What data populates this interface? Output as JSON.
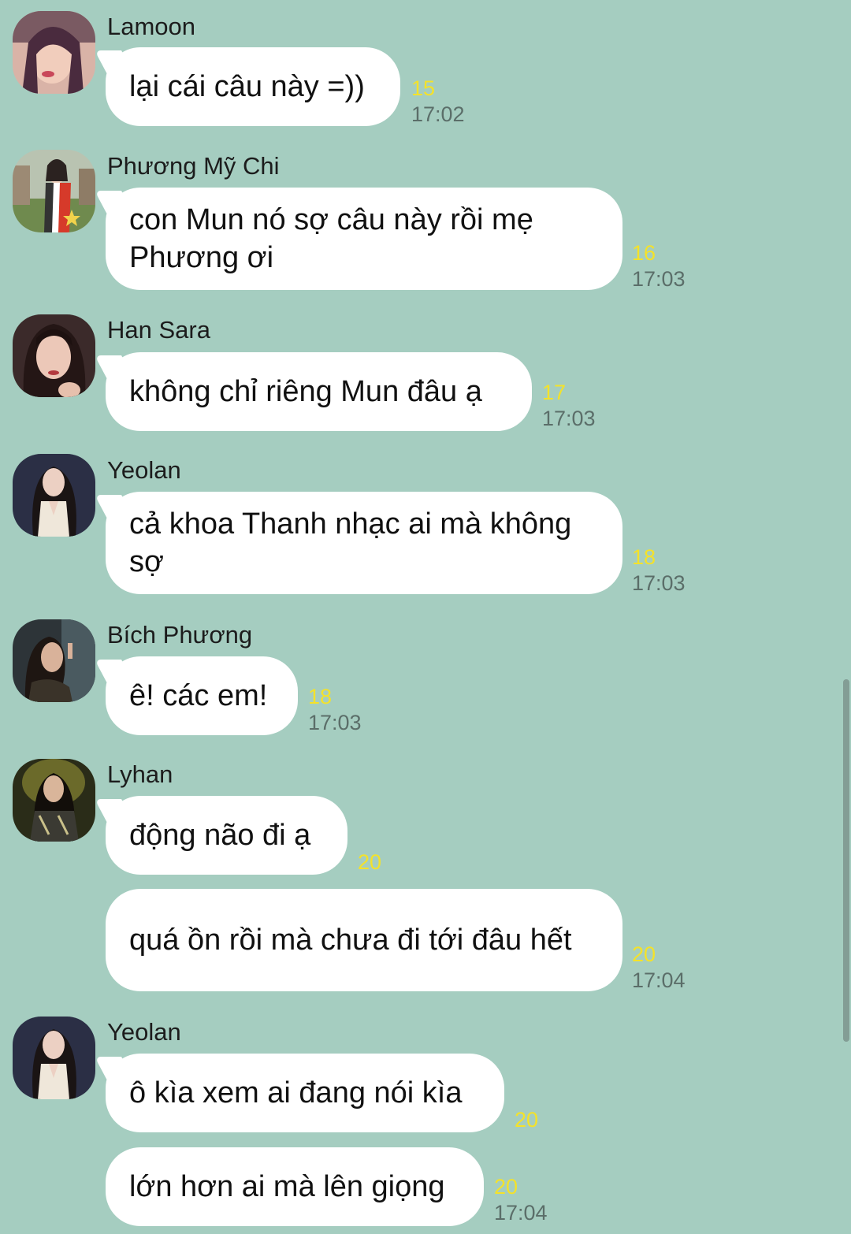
{
  "messages": [
    {
      "sender": "Lamoon",
      "text": "lại cái câu này =))",
      "count": "15",
      "time": "17:02",
      "avatar": "avatar-lamoon"
    },
    {
      "sender": "Phương Mỹ Chi",
      "text": "con Mun nó sợ câu này rồi mẹ Phương ơi",
      "count": "16",
      "time": "17:03",
      "avatar": "avatar-phuong-my-chi"
    },
    {
      "sender": "Han Sara",
      "text": "không chỉ riêng Mun đâu ạ",
      "count": "17",
      "time": "17:03",
      "avatar": "avatar-han-sara"
    },
    {
      "sender": "Yeolan",
      "text": "cả khoa Thanh nhạc ai mà không sợ",
      "count": "18",
      "time": "17:03",
      "avatar": "avatar-yeolan"
    },
    {
      "sender": "Bích Phương",
      "text": "ê! các em!",
      "count": "18",
      "time": "17:03",
      "avatar": "avatar-bich-phuong"
    },
    {
      "sender": "Lyhan",
      "text": "động não đi ạ",
      "count": "20",
      "time": "",
      "avatar": "avatar-lyhan"
    },
    {
      "sender": "",
      "text": "quá ồn rồi mà chưa đi tới đâu hết",
      "count": "20",
      "time": "17:04",
      "avatar": ""
    },
    {
      "sender": "Yeolan",
      "text": "ô kìa xem ai đang nói kìa",
      "count": "20",
      "time": "",
      "avatar": "avatar-yeolan"
    },
    {
      "sender": "",
      "text": "lớn hơn ai mà lên giọng",
      "count": "20",
      "time": "17:04",
      "avatar": ""
    }
  ],
  "colors": {
    "background": "#a5cdc0",
    "bubble": "#ffffff",
    "read_count": "#f4e22a",
    "timestamp": "#5b6e69"
  }
}
